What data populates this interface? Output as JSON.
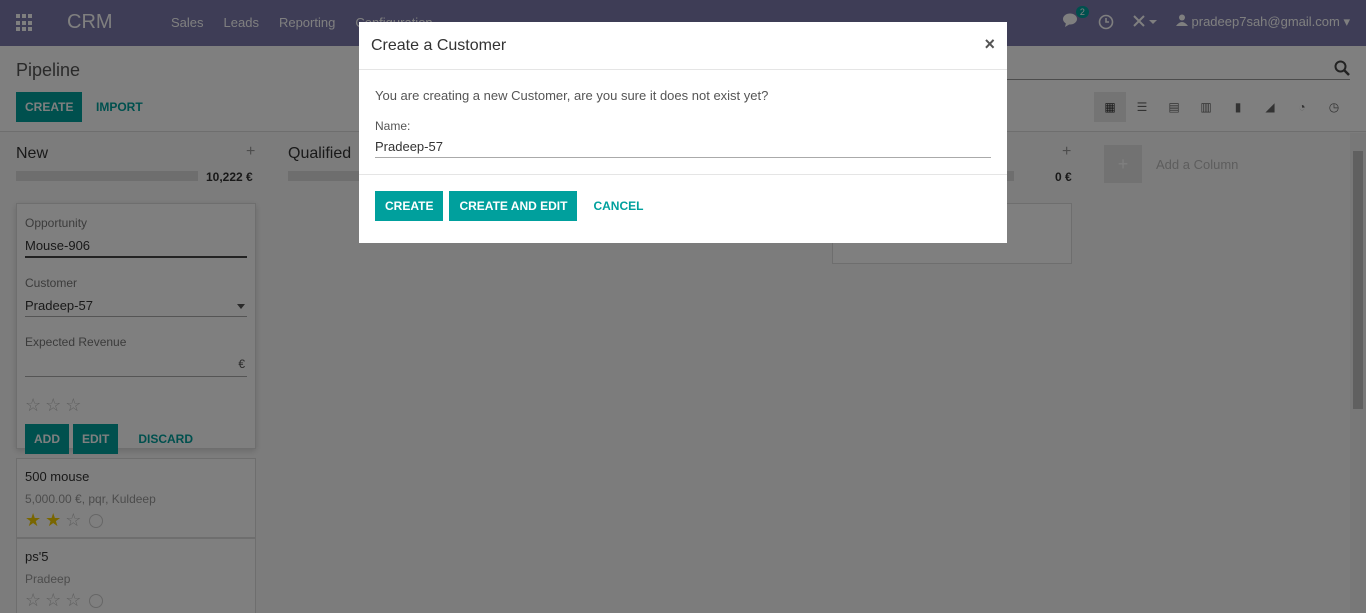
{
  "navbar": {
    "brand": "CRM",
    "menu": [
      "Sales",
      "Leads",
      "Reporting",
      "Configuration"
    ],
    "chat_count": "2",
    "user": "pradeep7sah@gmail.com"
  },
  "control": {
    "breadcrumb": "Pipeline",
    "create_label": "CREATE",
    "import_label": "IMPORT"
  },
  "kanban": {
    "columns": [
      {
        "title": "New",
        "sum": "10,222 €"
      },
      {
        "title": "Qualified",
        "sum": ""
      },
      {
        "title": "",
        "sum": "0 €"
      }
    ],
    "add_column_label": "Add a Column",
    "quick_create": {
      "opportunity_label": "Opportunity",
      "opportunity_value": "Mouse-906",
      "customer_label": "Customer",
      "customer_value": "Pradeep-57",
      "revenue_label": "Expected Revenue",
      "currency": "€",
      "add_label": "ADD",
      "edit_label": "EDIT",
      "discard_label": "DISCARD"
    },
    "cards": [
      {
        "title": "500 mouse",
        "subtitle": "5,000.00 €, pqr, Kuldeep",
        "stars_on": 2
      },
      {
        "title": "ps'5",
        "subtitle": "Pradeep",
        "stars_on": 0
      }
    ]
  },
  "modal": {
    "title": "Create a Customer",
    "close": "×",
    "message": "You are creating a new Customer, are you sure it does not exist yet?",
    "name_label": "Name:",
    "name_value": "Pradeep-57",
    "create_label": "CREATE",
    "create_edit_label": "CREATE AND EDIT",
    "cancel_label": "CANCEL"
  },
  "colors": {
    "navbar": "#7c7bad",
    "accent": "#00a09d",
    "star_on": "#f3cc00"
  }
}
